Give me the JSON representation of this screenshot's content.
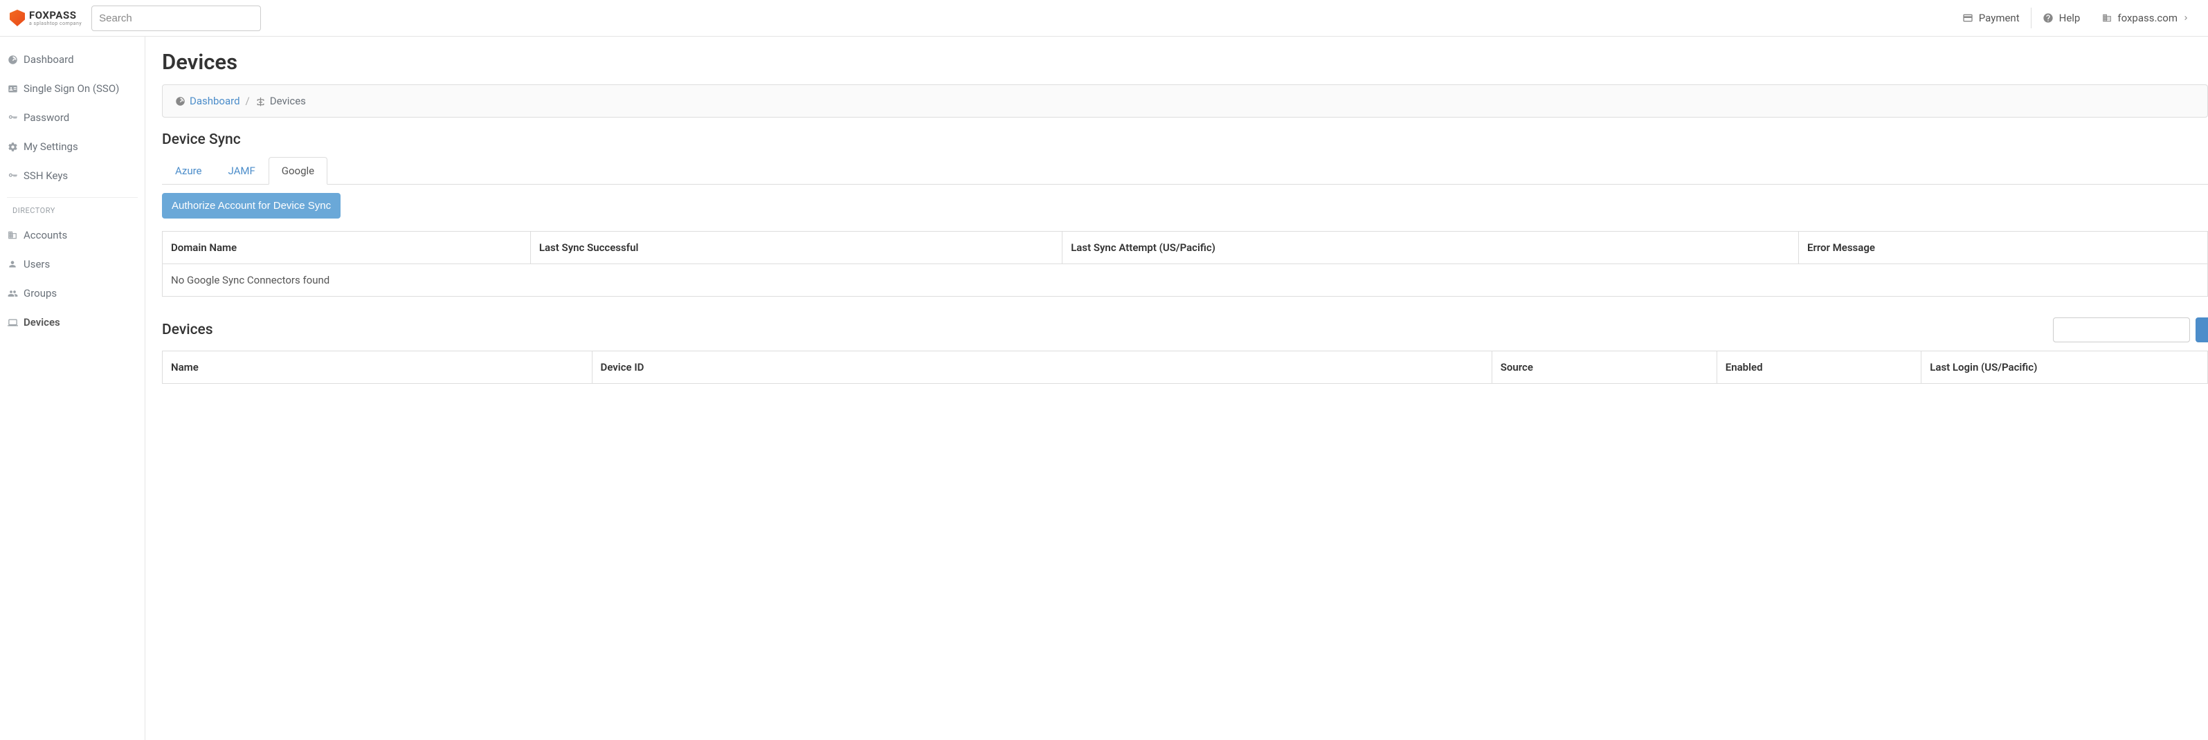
{
  "header": {
    "logo_main": "FOXPASS",
    "logo_sub": "a splashtop company",
    "search_placeholder": "Search",
    "nav": {
      "payment": "Payment",
      "help": "Help",
      "site": "foxpass.com"
    }
  },
  "sidebar": {
    "items_top": [
      {
        "label": "Dashboard",
        "icon": "gauge"
      },
      {
        "label": "Single Sign On (SSO)",
        "icon": "id-card"
      },
      {
        "label": "Password",
        "icon": "key"
      },
      {
        "label": "My Settings",
        "icon": "gears"
      },
      {
        "label": "SSH Keys",
        "icon": "key"
      }
    ],
    "section_header": "DIRECTORY",
    "items_directory": [
      {
        "label": "Accounts",
        "icon": "building"
      },
      {
        "label": "Users",
        "icon": "user"
      },
      {
        "label": "Groups",
        "icon": "users"
      },
      {
        "label": "Devices",
        "icon": "laptop",
        "active": true
      }
    ]
  },
  "page": {
    "title": "Devices",
    "breadcrumb": {
      "home": "Dashboard",
      "current": "Devices"
    },
    "device_sync": {
      "title": "Device Sync",
      "tabs": [
        "Azure",
        "JAMF",
        "Google"
      ],
      "active_tab": "Google",
      "authorize_button": "Authorize Account for Device Sync",
      "columns": [
        "Domain Name",
        "Last Sync Successful",
        "Last Sync Attempt (US/Pacific)",
        "Error Message"
      ],
      "empty_message": "No Google Sync Connectors found"
    },
    "devices_list": {
      "title": "Devices",
      "columns": [
        "Name",
        "Device ID",
        "Source",
        "Enabled",
        "Last Login (US/Pacific)"
      ]
    }
  }
}
